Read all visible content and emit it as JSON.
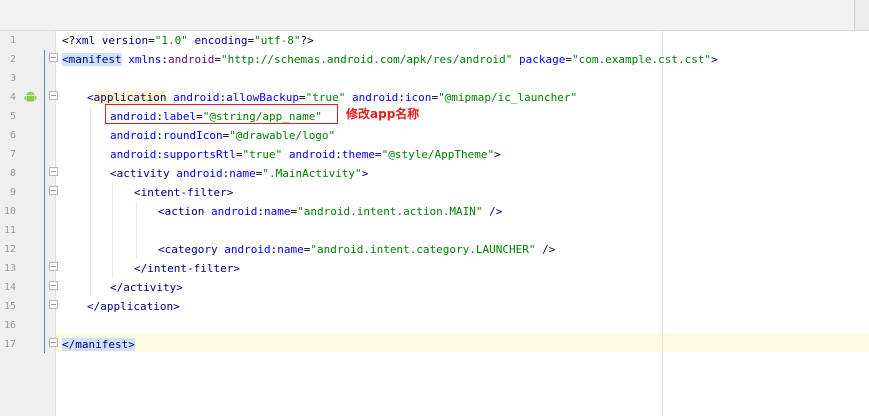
{
  "editor": {
    "line_numbers": [
      "1",
      "2",
      "3",
      "4",
      "5",
      "6",
      "7",
      "8",
      "9",
      "10",
      "11",
      "12",
      "13",
      "14",
      "15",
      "16",
      "17"
    ],
    "lines": {
      "l1": {
        "a": "<?",
        "b": "xml version",
        "c": "=",
        "d": "\"1.0\"",
        "e": " encoding",
        "f": "=",
        "g": "\"utf-8\"",
        "h": "?>"
      },
      "l2": {
        "a": "<",
        "b": "manifest",
        "c": " xmlns",
        "d": ":",
        "e": "android",
        "f": "=",
        "g": "\"http://schemas.android.com/apk/res/android\"",
        "h": " package",
        "i": "=",
        "j": "\"com.example.cst.cst\"",
        "k": ">"
      },
      "l4": {
        "a": "<",
        "b": "application",
        "c": " android",
        "d": ":",
        "e": "allowBackup",
        "f": "=",
        "g": "\"true\"",
        "h": " android",
        "i": ":",
        "j": "icon",
        "k": "=",
        "l": "\"@mipmap/ic_launcher\""
      },
      "l5": {
        "a": "android",
        "b": ":",
        "c": "label",
        "d": "=",
        "e": "\"@string/app_name\""
      },
      "l6": {
        "a": "android",
        "b": ":",
        "c": "roundIcon",
        "d": "=",
        "e": "\"@drawable/logo\""
      },
      "l7": {
        "a": "android",
        "b": ":",
        "c": "supportsRtl",
        "d": "=",
        "e": "\"true\"",
        "f": " android",
        "g": ":",
        "h": "theme",
        "i": "=",
        "j": "\"@style/AppTheme\"",
        "k": ">"
      },
      "l8": {
        "a": "<",
        "b": "activity",
        "c": " android",
        "d": ":",
        "e": "name",
        "f": "=",
        "g": "\".MainActivity\"",
        "h": ">"
      },
      "l9": {
        "a": "<",
        "b": "intent-filter",
        "c": ">"
      },
      "l10": {
        "a": "<",
        "b": "action",
        "c": " android",
        "d": ":",
        "e": "name",
        "f": "=",
        "g": "\"android.intent.action.MAIN\"",
        "h": " />"
      },
      "l12": {
        "a": "<",
        "b": "category",
        "c": " android",
        "d": ":",
        "e": "name",
        "f": "=",
        "g": "\"android.intent.category.LAUNCHER\"",
        "h": " />"
      },
      "l13": {
        "a": "</",
        "b": "intent-filter",
        "c": ">"
      },
      "l14": {
        "a": "</",
        "b": "activity",
        "c": ">"
      },
      "l15": {
        "a": "</",
        "b": "application",
        "c": ">"
      },
      "l17": {
        "a": "</",
        "b": "manifest",
        "c": ">"
      }
    }
  },
  "annotation": {
    "text": "修改app名称",
    "color": "#e02020"
  },
  "icons": {
    "gutter_icon": "android-icon"
  }
}
